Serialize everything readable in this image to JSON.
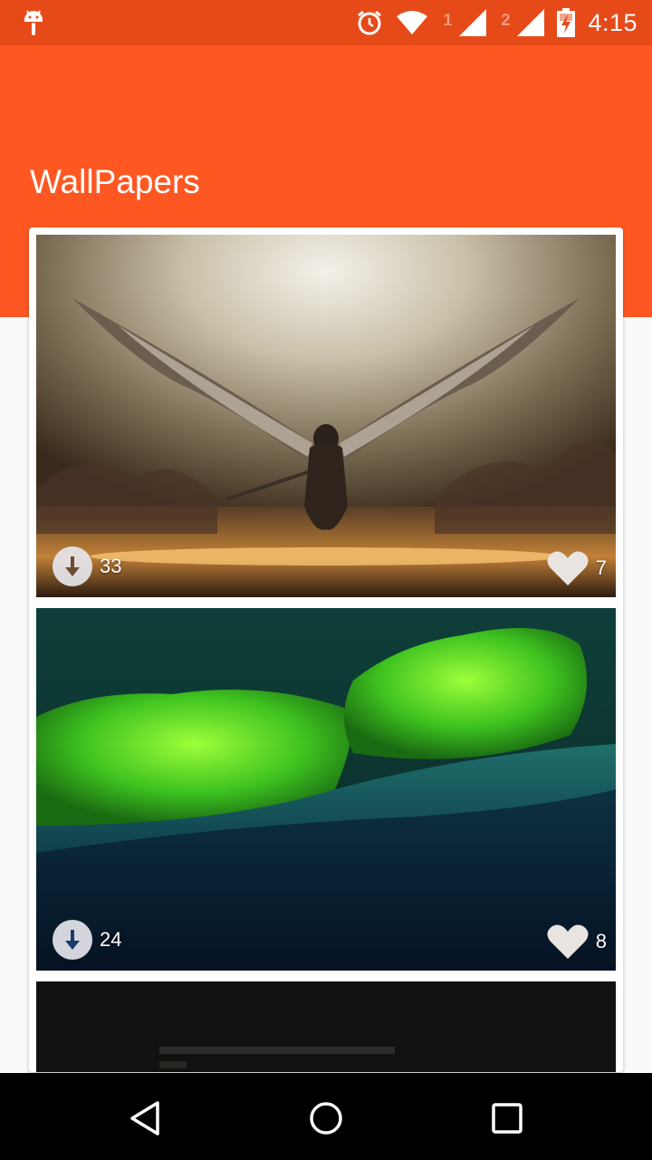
{
  "status_bar": {
    "time": "4:15",
    "sim1": "1",
    "sim2": "2",
    "icons": [
      "android-debug-icon",
      "alarm-icon",
      "wifi-icon",
      "signal-icon",
      "battery-charging-icon"
    ]
  },
  "app_bar": {
    "title": "WallPapers",
    "color": "#ff5722"
  },
  "wallpapers": [
    {
      "downloads": "33",
      "likes": "7",
      "image": "winged-angel-warrior"
    },
    {
      "downloads": "24",
      "likes": "8",
      "image": "green-moss-on-log"
    },
    {
      "image": "dark-code-text"
    }
  ],
  "nav_bar": {
    "buttons": [
      "back-icon",
      "home-icon",
      "recents-icon"
    ]
  }
}
